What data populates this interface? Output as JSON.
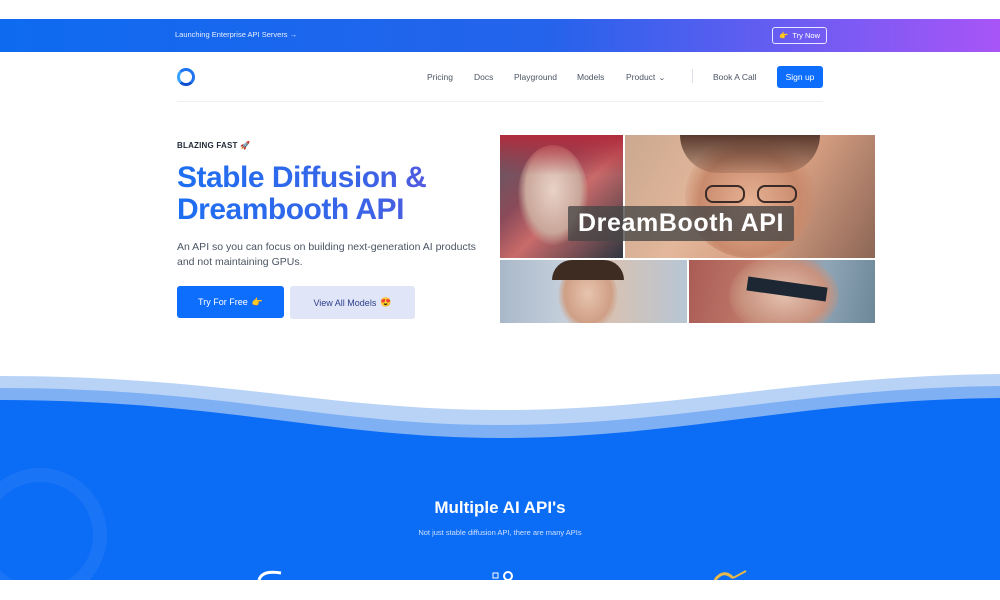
{
  "banner": {
    "text": "Launching Enterprise API Servers →",
    "cta_label": "Try Now",
    "cta_icon": "👉"
  },
  "nav": {
    "links": [
      "Pricing",
      "Docs",
      "Playground",
      "Models",
      "Product"
    ],
    "book_call": "Book A Call",
    "signup": "Sign up"
  },
  "hero": {
    "eyebrow": "BLAZING FAST 🚀",
    "title": "Stable Diffusion & Dreambooth API",
    "subtitle": "An API so you can focus on building next-generation AI products and not maintaining GPUs.",
    "primary_cta": "Try For Free",
    "primary_cta_icon": "👉",
    "secondary_cta": "View All Models",
    "secondary_cta_icon": "😍",
    "collage_label": "DreamBooth API"
  },
  "features": {
    "title": "Multiple AI API's",
    "subtitle": "Not just stable diffusion API, there are many APIs"
  },
  "colors": {
    "brand_blue": "#0d6efd",
    "banner_end": "#a855f7",
    "wave_blue": "#0b6cf6",
    "wave_light": "#9ec3f6"
  }
}
